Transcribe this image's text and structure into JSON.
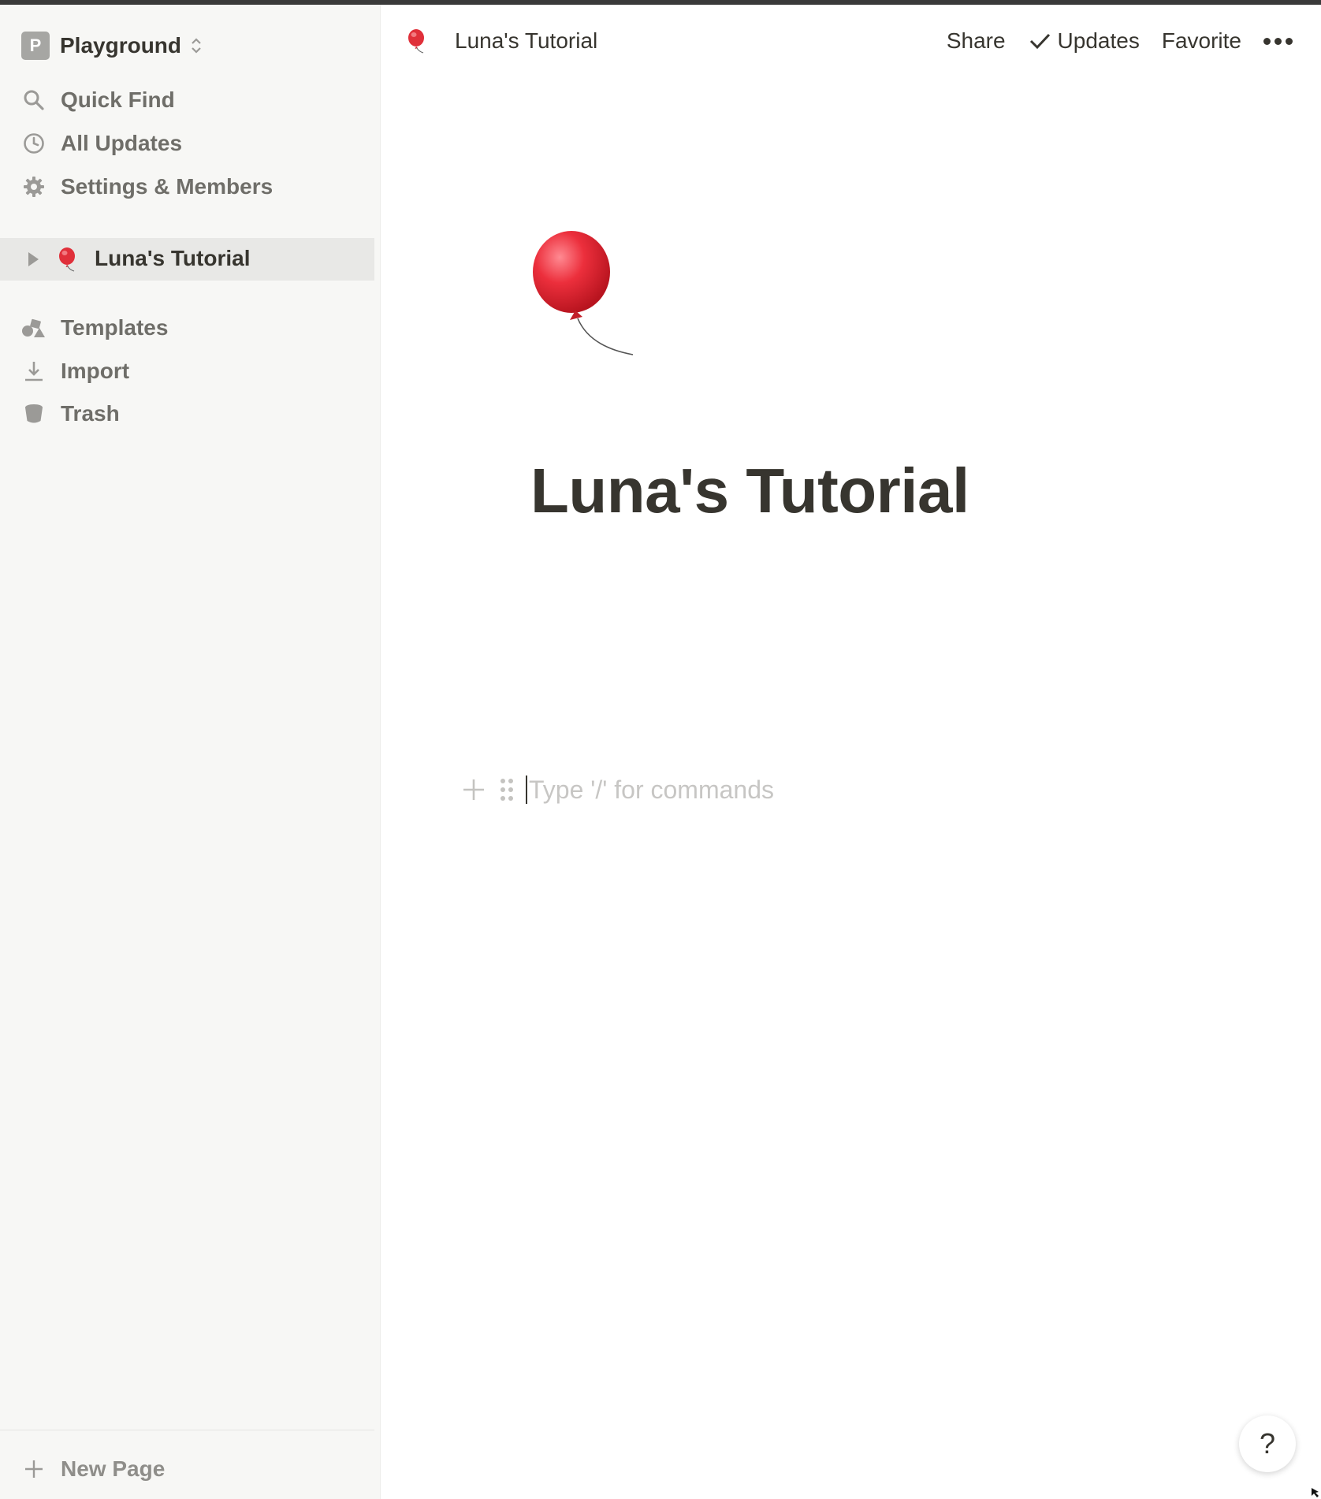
{
  "workspace": {
    "avatar_letter": "P",
    "name": "Playground"
  },
  "sidebar": {
    "nav": [
      {
        "label": "Quick Find",
        "icon": "search-icon"
      },
      {
        "label": "All Updates",
        "icon": "clock-icon"
      },
      {
        "label": "Settings & Members",
        "icon": "gear-icon"
      }
    ],
    "pages": [
      {
        "label": "Luna's Tutorial",
        "icon": "balloon-icon"
      }
    ],
    "tools": [
      {
        "label": "Templates",
        "icon": "templates-icon"
      },
      {
        "label": "Import",
        "icon": "import-icon"
      },
      {
        "label": "Trash",
        "icon": "trash-icon"
      }
    ],
    "new_page_label": "New Page"
  },
  "topbar": {
    "breadcrumb": "Luna's Tutorial",
    "share_label": "Share",
    "updates_label": "Updates",
    "favorite_label": "Favorite"
  },
  "page": {
    "title": "Luna's Tutorial",
    "placeholder": "Type '/' for commands"
  },
  "help_label": "?",
  "colors": {
    "sidebar_bg": "#f7f7f5",
    "selected_bg": "#e8e8e6",
    "text": "#37352f",
    "muted": "#6f6e69",
    "balloon": "#e0303a"
  }
}
